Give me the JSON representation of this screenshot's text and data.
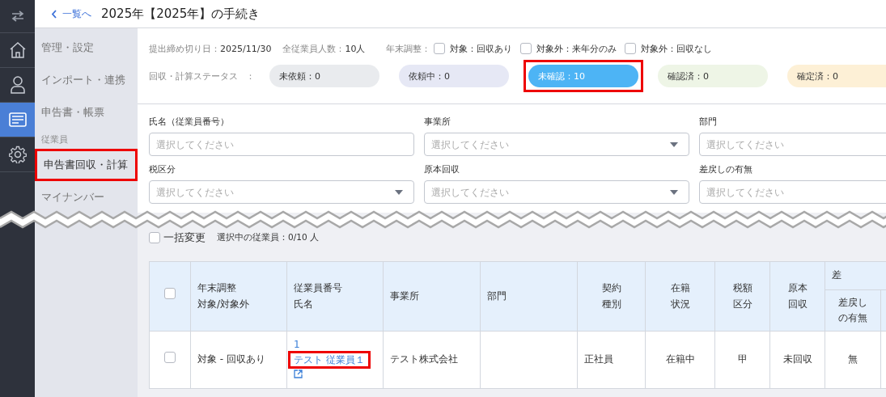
{
  "rail": [
    {
      "kind": "swap",
      "selected": false
    },
    {
      "kind": "home",
      "selected": false
    },
    {
      "kind": "person",
      "selected": false
    },
    {
      "kind": "card",
      "selected": true
    },
    {
      "kind": "gear",
      "selected": false
    }
  ],
  "header": {
    "back_link": "一覧へ",
    "title": "2025年【2025年】の手続き"
  },
  "sidebar": {
    "items": [
      {
        "kind": "item",
        "label": "管理・設定",
        "selected": false,
        "highlighted": false
      },
      {
        "kind": "item",
        "label": "インポート・連携",
        "selected": false,
        "highlighted": false
      },
      {
        "kind": "item",
        "label": "申告書・帳票",
        "selected": false,
        "highlighted": false
      },
      {
        "kind": "heading",
        "label": "従業員"
      },
      {
        "kind": "item",
        "label": "申告書回収・計算",
        "selected": true,
        "highlighted": true
      },
      {
        "kind": "item",
        "label": "マイナンバー",
        "selected": false,
        "highlighted": false
      }
    ]
  },
  "summary": {
    "deadline_label": "提出締め切り日：",
    "deadline": "2025/11/30",
    "headcount_label": "全従業員人数：",
    "headcount": "10人",
    "year_end_label": "年末調整：",
    "year_end_options": [
      {
        "label": "対象：回収あり",
        "checked": false
      },
      {
        "label": "対象外：来年分のみ",
        "checked": false
      },
      {
        "label": "対象外：回収なし",
        "checked": false
      }
    ]
  },
  "status": {
    "label": "回収・計算ステータス",
    "colon": "：",
    "pills": [
      {
        "label": "未依頼：0",
        "color": "#e9ebee",
        "selected": false,
        "highlighted": false
      },
      {
        "label": "依頼中：0",
        "color": "#e6e8f5",
        "selected": false,
        "highlighted": false
      },
      {
        "label": "未確認：10",
        "color": "#4db4f5",
        "selected": true,
        "highlighted": true
      },
      {
        "label": "確認済：0",
        "color": "#eef5e6",
        "selected": false,
        "highlighted": false
      },
      {
        "label": "確定済：0",
        "color": "#fdf0d6",
        "selected": false,
        "highlighted": false
      }
    ]
  },
  "filters": [
    {
      "label": "氏名（従業員番号）",
      "placeholder": "選択してください",
      "kind": "text"
    },
    {
      "label": "事業所",
      "placeholder": "選択してください",
      "kind": "select"
    },
    {
      "label": "部門",
      "placeholder": "選択してください",
      "kind": "text"
    },
    {
      "label": "税区分",
      "placeholder": "選択してください",
      "kind": "select"
    },
    {
      "label": "原本回収",
      "placeholder": "選択してください",
      "kind": "select"
    },
    {
      "label": "差戻しの有無",
      "placeholder": "選択してください",
      "kind": "text"
    }
  ],
  "bulk": {
    "label": "一括変更",
    "checked": false,
    "selection": "選択中の従業員：0/10 人"
  },
  "table": {
    "header_checked": false,
    "group_header": "差",
    "columns": [
      [
        "年末調整",
        "対象/対象外"
      ],
      [
        "従業員番号",
        "氏名"
      ],
      [
        "事業所"
      ],
      [
        "部門"
      ],
      [
        "契約",
        "種別"
      ],
      [
        "在籍",
        "状況"
      ],
      [
        "税額",
        "区分"
      ],
      [
        "原本",
        "回収"
      ],
      [
        "差戻し",
        "の有無"
      ]
    ],
    "rows": [
      {
        "checked": false,
        "year_end": "対象 - 回収あり",
        "employee_number": "1",
        "employee_name": "テスト 従業員１",
        "name_highlighted": true,
        "office": "テスト株式会社",
        "contract": "正社員",
        "status": "在籍中",
        "tax": "甲",
        "original": "未回収",
        "returned": "無"
      }
    ]
  }
}
